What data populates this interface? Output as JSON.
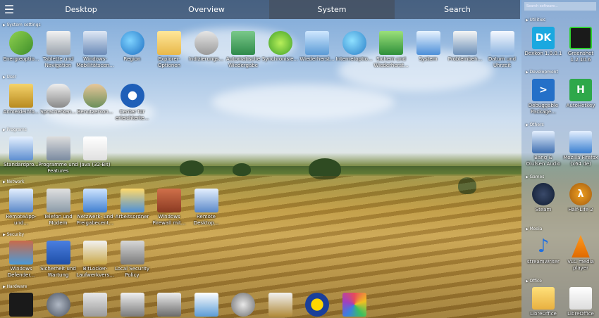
{
  "nav": {
    "menu_icon": "☰",
    "tabs": [
      "Desktop",
      "Overview",
      "System",
      "Search"
    ],
    "active": "System"
  },
  "categories": {
    "system_settings": "System settings",
    "user": "User",
    "programs": "Programs",
    "network": "Network",
    "security": "Security",
    "hardware": "Hardware"
  },
  "system_settings": [
    {
      "label": "Energieoptio...",
      "icon": "power-options-icon"
    },
    {
      "label": "Tablette und Navigation",
      "icon": "tablet-icon"
    },
    {
      "label": "Windows-Mobilitätscen...",
      "icon": "mobility-center-icon"
    },
    {
      "label": "Region",
      "icon": "globe-clock-icon"
    },
    {
      "label": "Explorer-Optionen",
      "icon": "folder-options-icon"
    },
    {
      "label": "Indizierungs...",
      "icon": "indexing-icon"
    },
    {
      "label": "Automatische Wiedergabe",
      "icon": "autoplay-icon"
    },
    {
      "label": "Synchronisie...",
      "icon": "sync-center-icon"
    },
    {
      "label": "Wiederherst...",
      "icon": "recovery-icon"
    },
    {
      "label": "Internetoptio...",
      "icon": "internet-options-icon"
    },
    {
      "label": "Sichern und Wiederherst...",
      "icon": "backup-icon"
    },
    {
      "label": "System",
      "icon": "system-icon"
    },
    {
      "label": "Problembeh...",
      "icon": "troubleshoot-icon"
    },
    {
      "label": "Datum und Uhrzeit",
      "icon": "date-time-icon"
    }
  ],
  "user": [
    {
      "label": "Anmeldeinfo...",
      "icon": "credential-icon"
    },
    {
      "label": "Spracherken...",
      "icon": "microphone-icon"
    },
    {
      "label": "Benutzerkon...",
      "icon": "users-icon"
    },
    {
      "label": "Center für erleichterte...",
      "icon": "ease-of-access-icon"
    }
  ],
  "programs": [
    {
      "label": "Standardpro...",
      "icon": "default-programs-icon"
    },
    {
      "label": "Programme und Features",
      "icon": "programs-features-icon"
    },
    {
      "label": "Java (32-Bit)",
      "icon": "java-icon"
    }
  ],
  "network": [
    {
      "label": "RemoteApp-und...",
      "icon": "remoteapp-icon"
    },
    {
      "label": "Telefon und Modem",
      "icon": "phone-modem-icon"
    },
    {
      "label": "Netzwerk- und Freigabecent...",
      "icon": "network-center-icon"
    },
    {
      "label": "Arbeitsordner",
      "icon": "work-folders-icon"
    },
    {
      "label": "Windows Firewall mit...",
      "icon": "firewall-icon"
    },
    {
      "label": "Remote Desktop...",
      "icon": "remote-desktop-icon"
    }
  ],
  "security": [
    {
      "label": "Windows Defender...",
      "icon": "defender-icon"
    },
    {
      "label": "Sicherheit und Wartung",
      "icon": "security-flag-icon"
    },
    {
      "label": "BitLocker-Laufwerkvers...",
      "icon": "bitlocker-icon"
    },
    {
      "label": "Local Security Policy",
      "icon": "security-policy-icon"
    }
  ],
  "hardware": [
    {
      "label": "",
      "icon": "bang-olufsen-icon"
    },
    {
      "label": "",
      "icon": "mouse-icon"
    },
    {
      "label": "",
      "icon": "keyboard-icon"
    },
    {
      "label": "",
      "icon": "devices-icon"
    },
    {
      "label": "",
      "icon": "printer-icon"
    },
    {
      "label": "",
      "icon": "display-icon"
    },
    {
      "label": "",
      "icon": "sound-icon"
    },
    {
      "label": "",
      "icon": "device-manager-icon"
    },
    {
      "label": "",
      "icon": "x-app-icon"
    },
    {
      "label": "",
      "icon": "color-app-icon"
    }
  ],
  "panel": {
    "search_placeholder": "Search software...",
    "categories": {
      "utilities": "Utilities",
      "development": "Development",
      "others": "Others",
      "games": "Games",
      "media": "Media",
      "office": "Office"
    },
    "utilities": [
      {
        "label": "Dexkon 1.0.0.1",
        "icon": "dk-icon",
        "glyph": "DK"
      },
      {
        "label": "Greenshot 1.2.10.6",
        "icon": "greenshot-icon",
        "glyph": ""
      }
    ],
    "development": [
      {
        "label": "Debuggable Package...",
        "icon": "powershell-icon",
        "glyph": ">"
      },
      {
        "label": "AutoHotkey",
        "icon": "autohotkey-icon",
        "glyph": "H"
      }
    ],
    "others": [
      {
        "label": "Bang & Olufsen Audio",
        "icon": "bo-audio-icon",
        "glyph": ""
      },
      {
        "label": "Mozilla Firefox (x64 de)",
        "icon": "firefox-icon",
        "glyph": ""
      }
    ],
    "games": [
      {
        "label": "Steam",
        "icon": "steam-icon",
        "glyph": ""
      },
      {
        "label": "Half-Life 2",
        "icon": "half-life-icon",
        "glyph": "λ"
      }
    ],
    "media": [
      {
        "label": "streamWriter",
        "icon": "music-note-icon",
        "glyph": "♪"
      },
      {
        "label": "VLC media player",
        "icon": "vlc-icon",
        "glyph": ""
      }
    ],
    "office": [
      {
        "label": "LibreOffice",
        "icon": "libreoffice-icon",
        "glyph": ""
      },
      {
        "label": "LibreOffice",
        "icon": "document-icon",
        "glyph": ""
      }
    ]
  },
  "colors": {
    "topbar": "#2a3448",
    "active_tab": "#48505f",
    "panel": "#96afd2"
  }
}
